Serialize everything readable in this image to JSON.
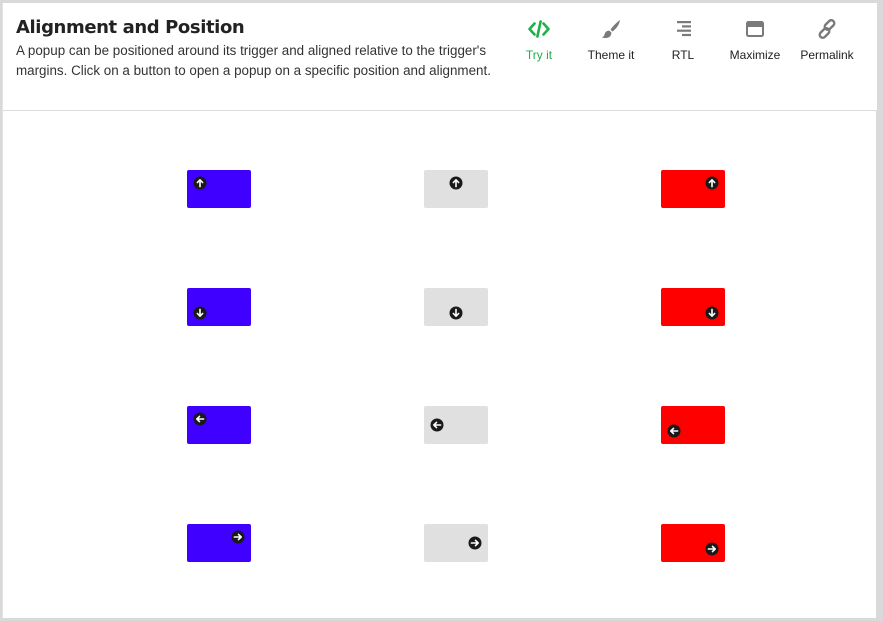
{
  "header": {
    "title": "Alignment and Position",
    "description": "A popup can be positioned around its trigger and aligned relative to the trigger's margins. Click on a button to open a popup on a specific position and alignment."
  },
  "toolbar": [
    {
      "id": "try-it",
      "label": "Try it",
      "icon": "code-icon",
      "active": true
    },
    {
      "id": "theme-it",
      "label": "Theme it",
      "icon": "brush-icon",
      "active": false
    },
    {
      "id": "rtl",
      "label": "RTL",
      "icon": "align-right-icon",
      "active": false
    },
    {
      "id": "maximize",
      "label": "Maximize",
      "icon": "window-icon",
      "active": false
    },
    {
      "id": "permalink",
      "label": "Permalink",
      "icon": "link-icon",
      "active": false
    }
  ],
  "colors": {
    "accent": "#1fb04a",
    "icon": "#7a7a7a",
    "blue": "#3f00ff",
    "gray": "#e0e0e0",
    "red": "#ff0000"
  },
  "popup_buttons": [
    {
      "row": 1,
      "col": 1,
      "color": "blue",
      "arrow": "up",
      "align": "left-top"
    },
    {
      "row": 1,
      "col": 2,
      "color": "gray",
      "arrow": "up",
      "align": "center-top"
    },
    {
      "row": 1,
      "col": 3,
      "color": "red",
      "arrow": "up",
      "align": "right-top"
    },
    {
      "row": 2,
      "col": 1,
      "color": "blue",
      "arrow": "down",
      "align": "left-bottom"
    },
    {
      "row": 2,
      "col": 2,
      "color": "gray",
      "arrow": "down",
      "align": "center-bottom"
    },
    {
      "row": 2,
      "col": 3,
      "color": "red",
      "arrow": "down",
      "align": "right-bottom"
    },
    {
      "row": 3,
      "col": 1,
      "color": "blue",
      "arrow": "left",
      "align": "left-top"
    },
    {
      "row": 3,
      "col": 2,
      "color": "gray",
      "arrow": "left",
      "align": "left-middle"
    },
    {
      "row": 3,
      "col": 3,
      "color": "red",
      "arrow": "left",
      "align": "left-bottom"
    },
    {
      "row": 4,
      "col": 1,
      "color": "blue",
      "arrow": "right",
      "align": "right-top"
    },
    {
      "row": 4,
      "col": 2,
      "color": "gray",
      "arrow": "right",
      "align": "right-middle"
    },
    {
      "row": 4,
      "col": 3,
      "color": "red",
      "arrow": "right",
      "align": "right-bottom"
    }
  ]
}
